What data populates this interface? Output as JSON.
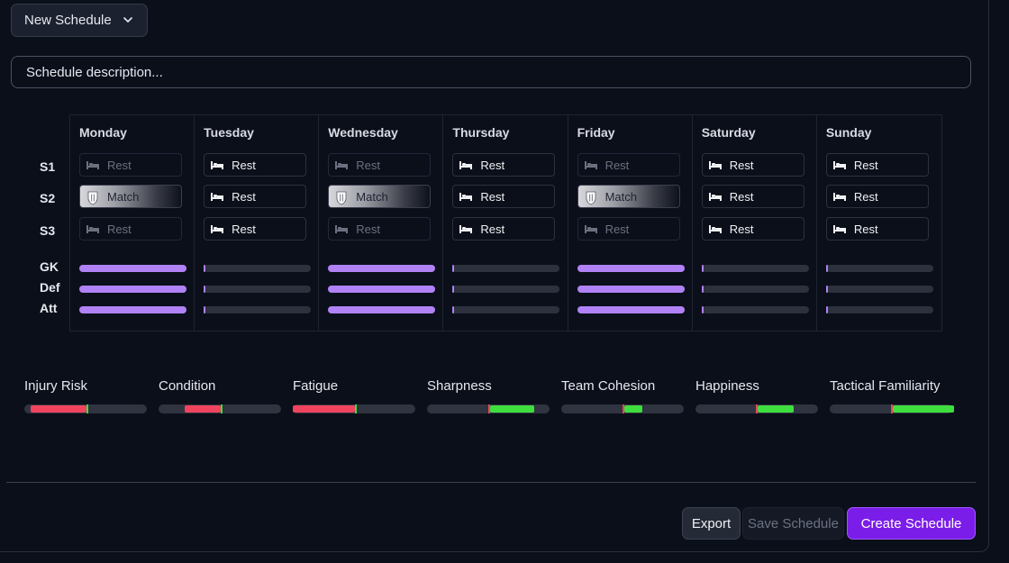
{
  "header": {
    "schedule_select": "New Schedule",
    "description_placeholder": "Schedule description..."
  },
  "rows": {
    "sessions": [
      "S1",
      "S2",
      "S3"
    ],
    "positions": [
      "GK",
      "Def",
      "Att"
    ]
  },
  "days": [
    {
      "name": "Monday",
      "slots": [
        {
          "label": "Rest",
          "type": "rest-dim"
        },
        {
          "label": "Match",
          "type": "match"
        },
        {
          "label": "Rest",
          "type": "rest-dim"
        }
      ],
      "load": [
        1,
        1,
        1
      ]
    },
    {
      "name": "Tuesday",
      "slots": [
        {
          "label": "Rest",
          "type": "rest"
        },
        {
          "label": "Rest",
          "type": "rest"
        },
        {
          "label": "Rest",
          "type": "rest"
        }
      ],
      "load": [
        0,
        0,
        0
      ]
    },
    {
      "name": "Wednesday",
      "slots": [
        {
          "label": "Rest",
          "type": "rest-dim"
        },
        {
          "label": "Match",
          "type": "match"
        },
        {
          "label": "Rest",
          "type": "rest-dim"
        }
      ],
      "load": [
        1,
        1,
        1
      ]
    },
    {
      "name": "Thursday",
      "slots": [
        {
          "label": "Rest",
          "type": "rest"
        },
        {
          "label": "Rest",
          "type": "rest"
        },
        {
          "label": "Rest",
          "type": "rest"
        }
      ],
      "load": [
        0,
        0,
        0
      ]
    },
    {
      "name": "Friday",
      "slots": [
        {
          "label": "Rest",
          "type": "rest-dim"
        },
        {
          "label": "Match",
          "type": "match"
        },
        {
          "label": "Rest",
          "type": "rest-dim"
        }
      ],
      "load": [
        1,
        1,
        1
      ]
    },
    {
      "name": "Saturday",
      "slots": [
        {
          "label": "Rest",
          "type": "rest"
        },
        {
          "label": "Rest",
          "type": "rest"
        },
        {
          "label": "Rest",
          "type": "rest"
        }
      ],
      "load": [
        0,
        0,
        0
      ]
    },
    {
      "name": "Sunday",
      "slots": [
        {
          "label": "Rest",
          "type": "rest"
        },
        {
          "label": "Rest",
          "type": "rest"
        },
        {
          "label": "Rest",
          "type": "rest"
        }
      ],
      "load": [
        0,
        0,
        0
      ]
    }
  ],
  "metrics": [
    {
      "name": "Injury Risk",
      "baseline": 0.51,
      "change": -0.46
    },
    {
      "name": "Condition",
      "baseline": 0.51,
      "change": -0.3
    },
    {
      "name": "Fatigue",
      "baseline": 0.51,
      "change": -0.51
    },
    {
      "name": "Sharpness",
      "baseline": 0.5,
      "change": 0.36
    },
    {
      "name": "Team Cohesion",
      "baseline": 0.5,
      "change": 0.15
    },
    {
      "name": "Happiness",
      "baseline": 0.49,
      "change": 0.3
    },
    {
      "name": "Tactical Familiarity",
      "baseline": 0.5,
      "change": 0.5
    }
  ],
  "colors": {
    "load_fill": "#b082f5",
    "negative": "#f0445e",
    "positive": "#3fde3f",
    "accent": "#7b1de8"
  },
  "icons": {
    "rest": "bed-icon",
    "match": "shield-icon",
    "select": "chevron-down-icon"
  },
  "actions": {
    "export": "Export",
    "save": "Save Schedule",
    "create": "Create Schedule"
  }
}
